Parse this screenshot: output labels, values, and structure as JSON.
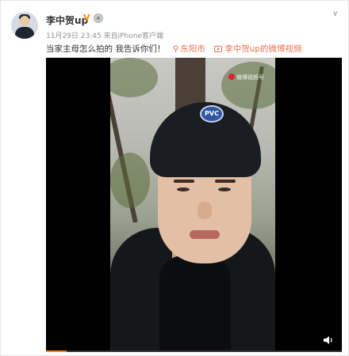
{
  "post": {
    "username": "李中贺up",
    "time": "11月29日 23:45",
    "source": "来自iPhone客户端",
    "text": "当家主母怎么拍的 我告诉你们！",
    "location": "东阳市",
    "video_link": "李中贺up的微博视频"
  },
  "player": {
    "watermark": "微博视频号",
    "cap_logo": "PVC",
    "progress": 0.07
  },
  "icons": {
    "verified": "verified-v-icon",
    "level": "level-badge-icon",
    "more": "chevron-down-icon",
    "location": "location-pin-icon",
    "video": "video-icon",
    "volume": "volume-icon"
  },
  "colors": {
    "link": "#eb7350",
    "verified": "#ff8200",
    "meta": "#939393"
  }
}
